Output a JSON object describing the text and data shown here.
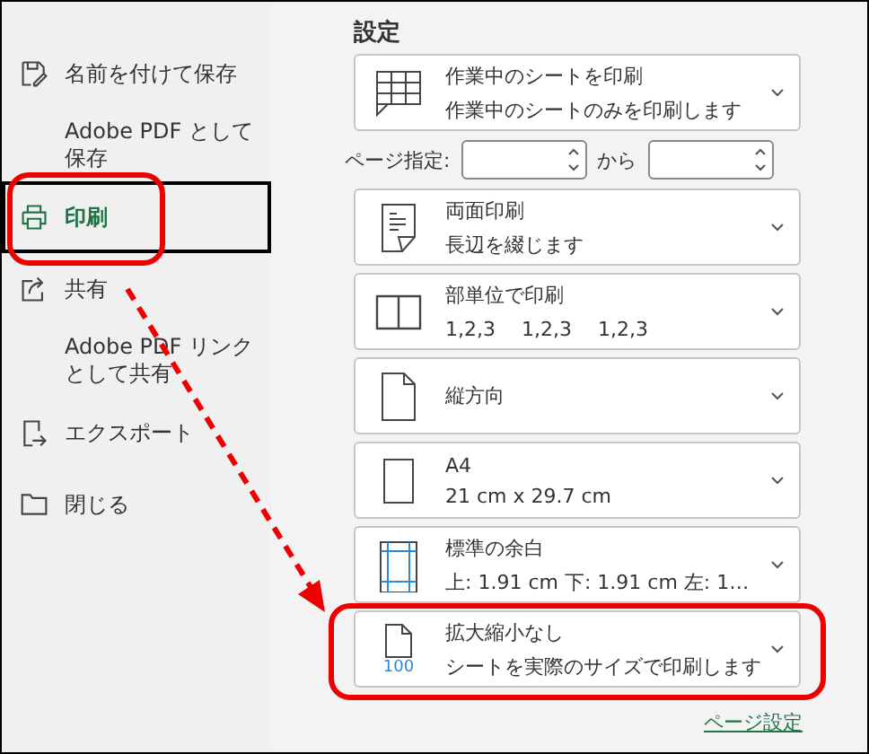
{
  "sidebar": {
    "items": [
      {
        "label": "名前を付けて保存",
        "selected": false,
        "highlighted": false
      },
      {
        "label": "Adobe PDF として保存",
        "selected": false,
        "highlighted": false
      },
      {
        "label": "印刷",
        "selected": true,
        "highlighted": true
      },
      {
        "label": "共有",
        "selected": false,
        "highlighted": false
      },
      {
        "label": "Adobe PDF リンクとして共有",
        "selected": false,
        "highlighted": false
      },
      {
        "label": "エクスポート",
        "selected": false,
        "highlighted": false
      },
      {
        "label": "閉じる",
        "selected": false,
        "highlighted": false
      }
    ]
  },
  "settings": {
    "heading": "設定",
    "cards_top": [
      {
        "title": "作業中のシートを印刷",
        "subtitle": "作業中のシートのみを印刷します"
      }
    ],
    "page_range": {
      "label": "ページ指定:",
      "separator": "から"
    },
    "cards": [
      {
        "title": "両面印刷",
        "subtitle": "長辺を綴じます",
        "highlighted": false
      },
      {
        "title": "部単位で印刷",
        "subtitle": "1,2,3　 1,2,3　 1,2,3",
        "highlighted": false
      },
      {
        "title": "縦方向",
        "highlighted": false
      },
      {
        "title": "A4",
        "subtitle": "21 cm x 29.7 cm",
        "highlighted": false
      },
      {
        "title": "標準の余白",
        "subtitle": "上: 1.91 cm 下: 1.91 cm 左: 1…",
        "highlighted": false
      },
      {
        "title": "拡大縮小なし",
        "subtitle": "シートを実際のサイズで印刷します",
        "icon_text": "100",
        "highlighted": true
      }
    ],
    "link": "ページ設定"
  }
}
